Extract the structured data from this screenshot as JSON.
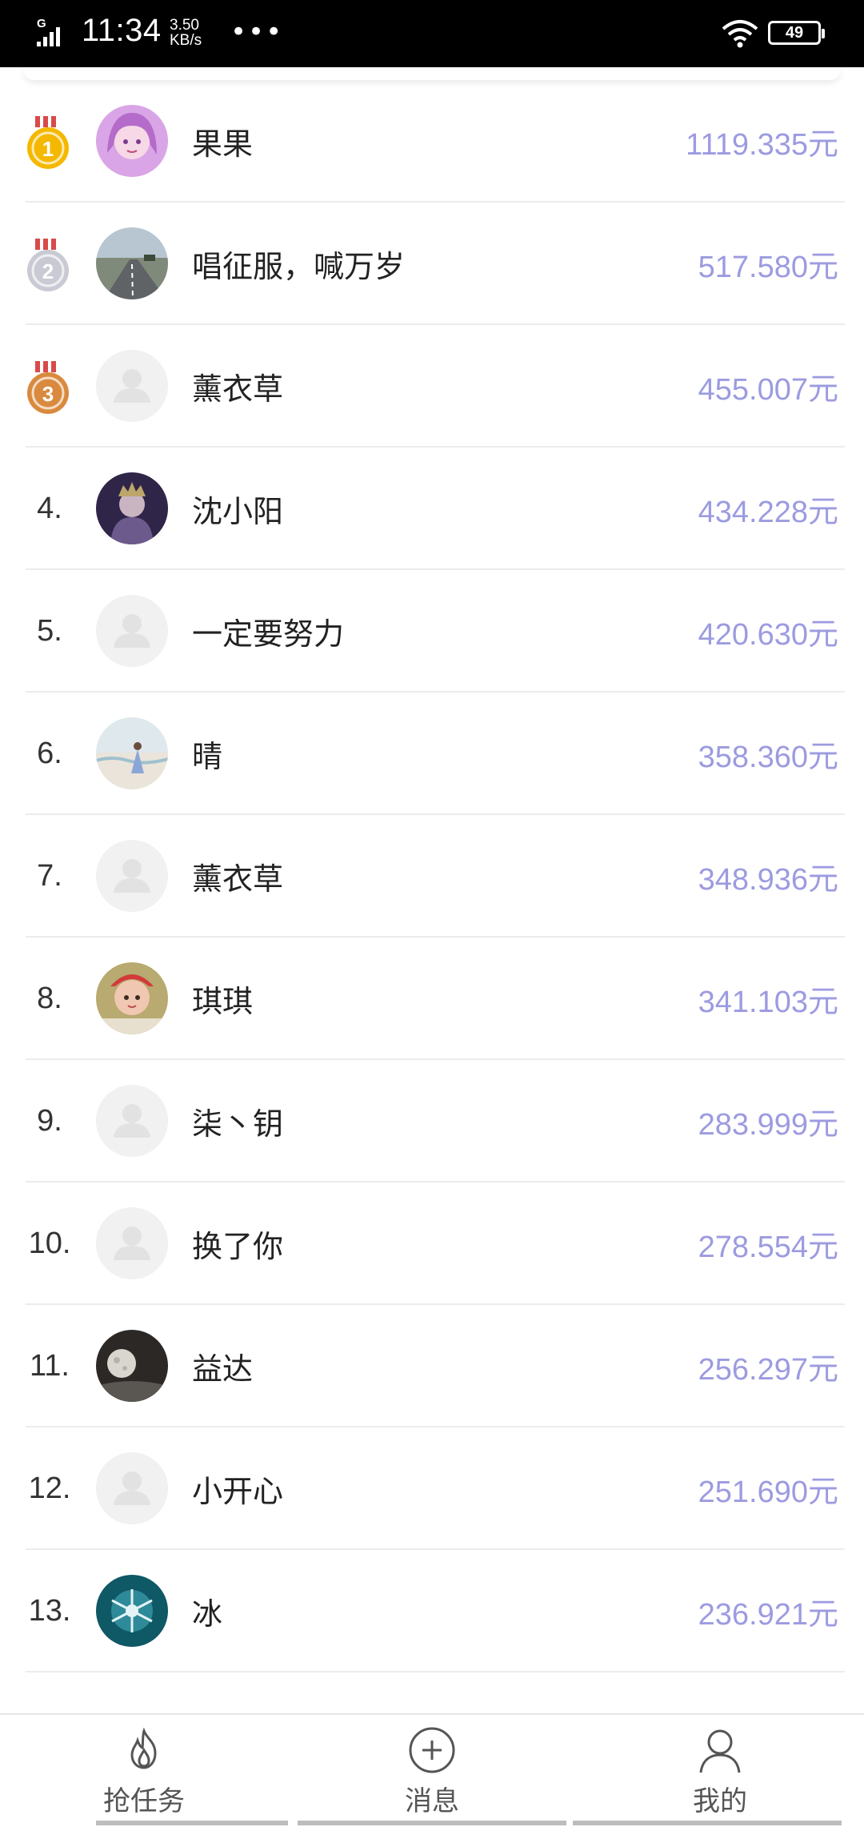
{
  "status_bar": {
    "network": "G",
    "time": "11:34",
    "speed_value": "3.50",
    "speed_unit": "KB/s",
    "more": "•••",
    "battery": "49"
  },
  "list": [
    {
      "rank": "",
      "medal": "1",
      "name": "果果",
      "amount": "1119.335元",
      "avatar": "anime-girl"
    },
    {
      "rank": "",
      "medal": "2",
      "name": "唱征服，喊万岁",
      "amount": "517.580元",
      "avatar": "road"
    },
    {
      "rank": "",
      "medal": "3",
      "name": "薰衣草",
      "amount": "455.007元",
      "avatar": "default"
    },
    {
      "rank": "4.",
      "medal": "",
      "name": "沈小阳",
      "amount": "434.228元",
      "avatar": "portrait-dark"
    },
    {
      "rank": "5.",
      "medal": "",
      "name": "一定要努力",
      "amount": "420.630元",
      "avatar": "default"
    },
    {
      "rank": "6.",
      "medal": "",
      "name": "晴",
      "amount": "358.360元",
      "avatar": "beach"
    },
    {
      "rank": "7.",
      "medal": "",
      "name": "薰衣草",
      "amount": "348.936元",
      "avatar": "default"
    },
    {
      "rank": "8.",
      "medal": "",
      "name": "琪琪",
      "amount": "341.103元",
      "avatar": "baby"
    },
    {
      "rank": "9.",
      "medal": "",
      "name": "柒丶钥",
      "amount": "283.999元",
      "avatar": "default"
    },
    {
      "rank": "10.",
      "medal": "",
      "name": "换了你",
      "amount": "278.554元",
      "avatar": "default"
    },
    {
      "rank": "11.",
      "medal": "",
      "name": "益达",
      "amount": "256.297元",
      "avatar": "moon"
    },
    {
      "rank": "12.",
      "medal": "",
      "name": "小开心",
      "amount": "251.690元",
      "avatar": "default"
    },
    {
      "rank": "13.",
      "medal": "",
      "name": "冰",
      "amount": "236.921元",
      "avatar": "ice"
    }
  ],
  "bottom_nav": {
    "tasks_label": "抢任务",
    "messages_label": "消息",
    "mine_label": "我的",
    "tasks_icon": "flame-icon",
    "messages_icon": "plus-circle-icon",
    "mine_icon": "user-icon"
  },
  "colors": {
    "amount": "#9c9be0",
    "gold": "#f5b800",
    "silver": "#c9cad3",
    "bronze": "#d98a3e"
  }
}
